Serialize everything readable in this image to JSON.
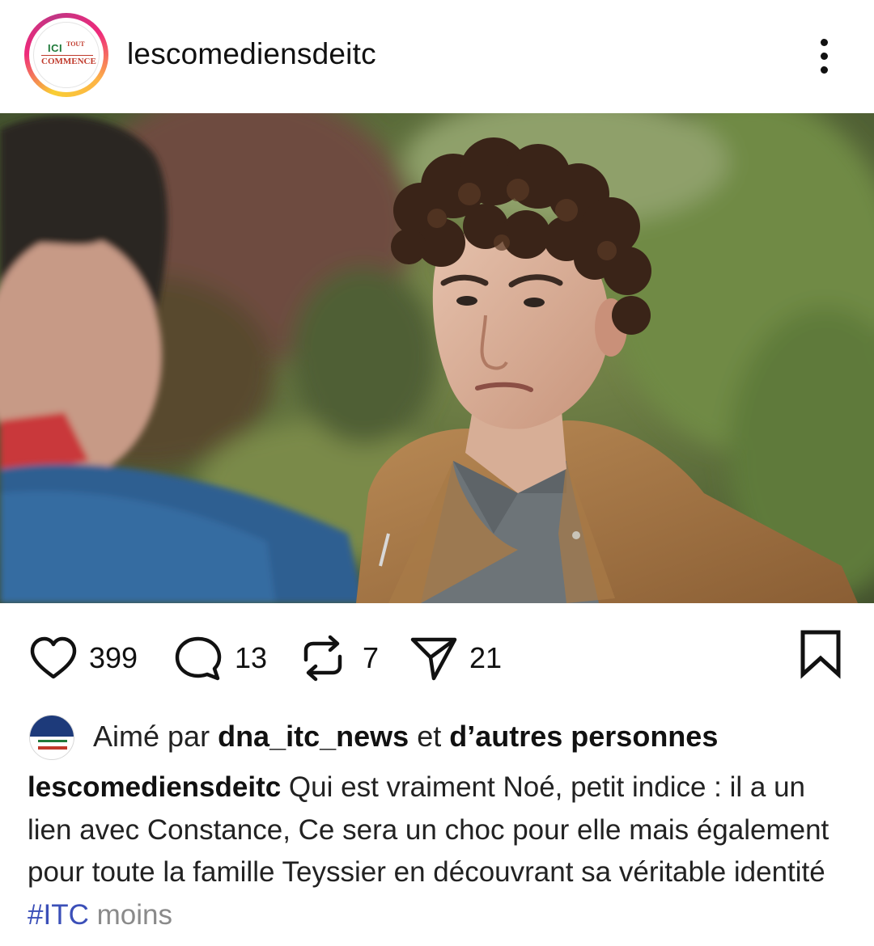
{
  "post": {
    "username": "lescomediensdeitc",
    "avatar": {
      "logo_line1": "ICI",
      "logo_line1b": "TOUT",
      "logo_line2": "COMMENCE"
    },
    "more_icon": "more-vertical-icon"
  },
  "image": {
    "description_icon": "video-frame"
  },
  "actions": {
    "likes": "399",
    "comments": "13",
    "reposts": "7",
    "shares": "21",
    "icons": [
      "heart-icon",
      "comment-icon",
      "repost-icon",
      "send-icon",
      "bookmark-icon"
    ]
  },
  "liked_by": {
    "prefix": "Aimé par",
    "user": "dna_itc_news",
    "conj": "et",
    "others": "d’autres personnes"
  },
  "caption": {
    "user": "lescomediensdeitc",
    "text": " Qui est vraiment Noé, petit indice : il a un lien avec Constance, Ce sera un choc pour elle mais également pour toute la famille Teyssier en découvrant sa véritable identité ",
    "hashtag": "#ITC",
    "more": " moins"
  },
  "colors": {
    "hashtag": "#3b4fb8",
    "more": "#8a8a8a",
    "text": "#111111"
  }
}
